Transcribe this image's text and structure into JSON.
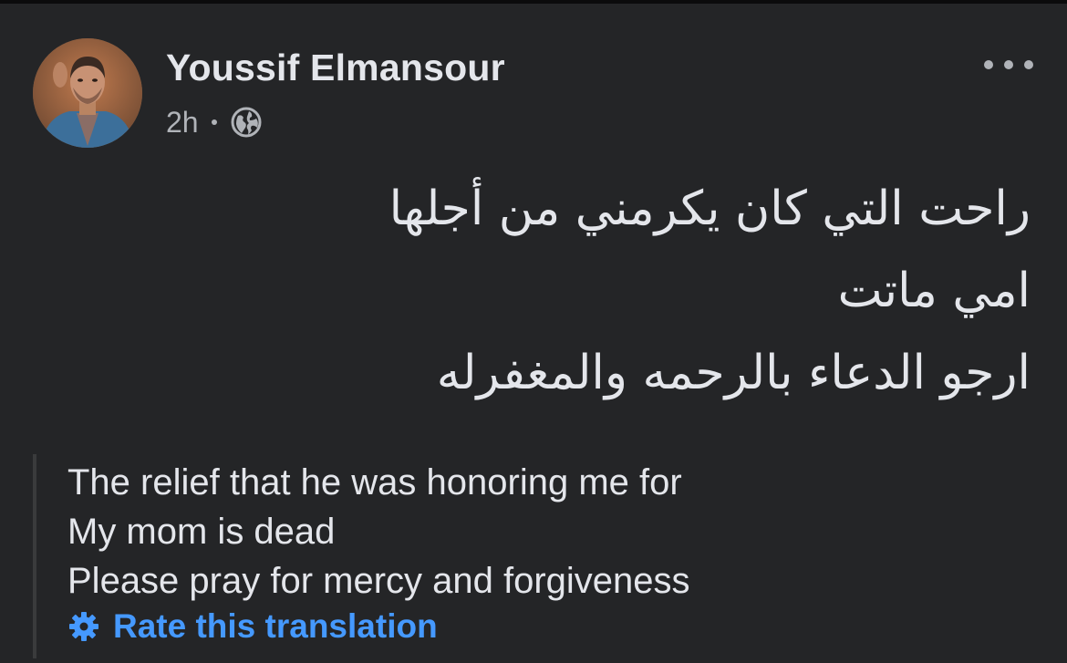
{
  "post": {
    "author": {
      "name": "Youssif Elmansour",
      "avatar_icon": "profile-photo"
    },
    "timestamp": "2h",
    "audience_icon": "globe-icon",
    "more_icon": "more-options-icon",
    "text_lines": [
      "راحت التي كان يكرمني من أجلها",
      "امي ماتت",
      "ارجو الدعاء بالرحمه والمغفرله"
    ],
    "translation": {
      "lines": [
        "The relief that he was honoring me for",
        "My mom is dead",
        "Please pray for mercy and forgiveness"
      ],
      "rate_label": "Rate this translation",
      "rate_icon": "gear-icon"
    }
  },
  "colors": {
    "background": "#242527",
    "text_primary": "#e4e6eb",
    "text_secondary": "#b0b3b8",
    "link": "#4599ff",
    "quote_bar": "#3a3b3c"
  }
}
